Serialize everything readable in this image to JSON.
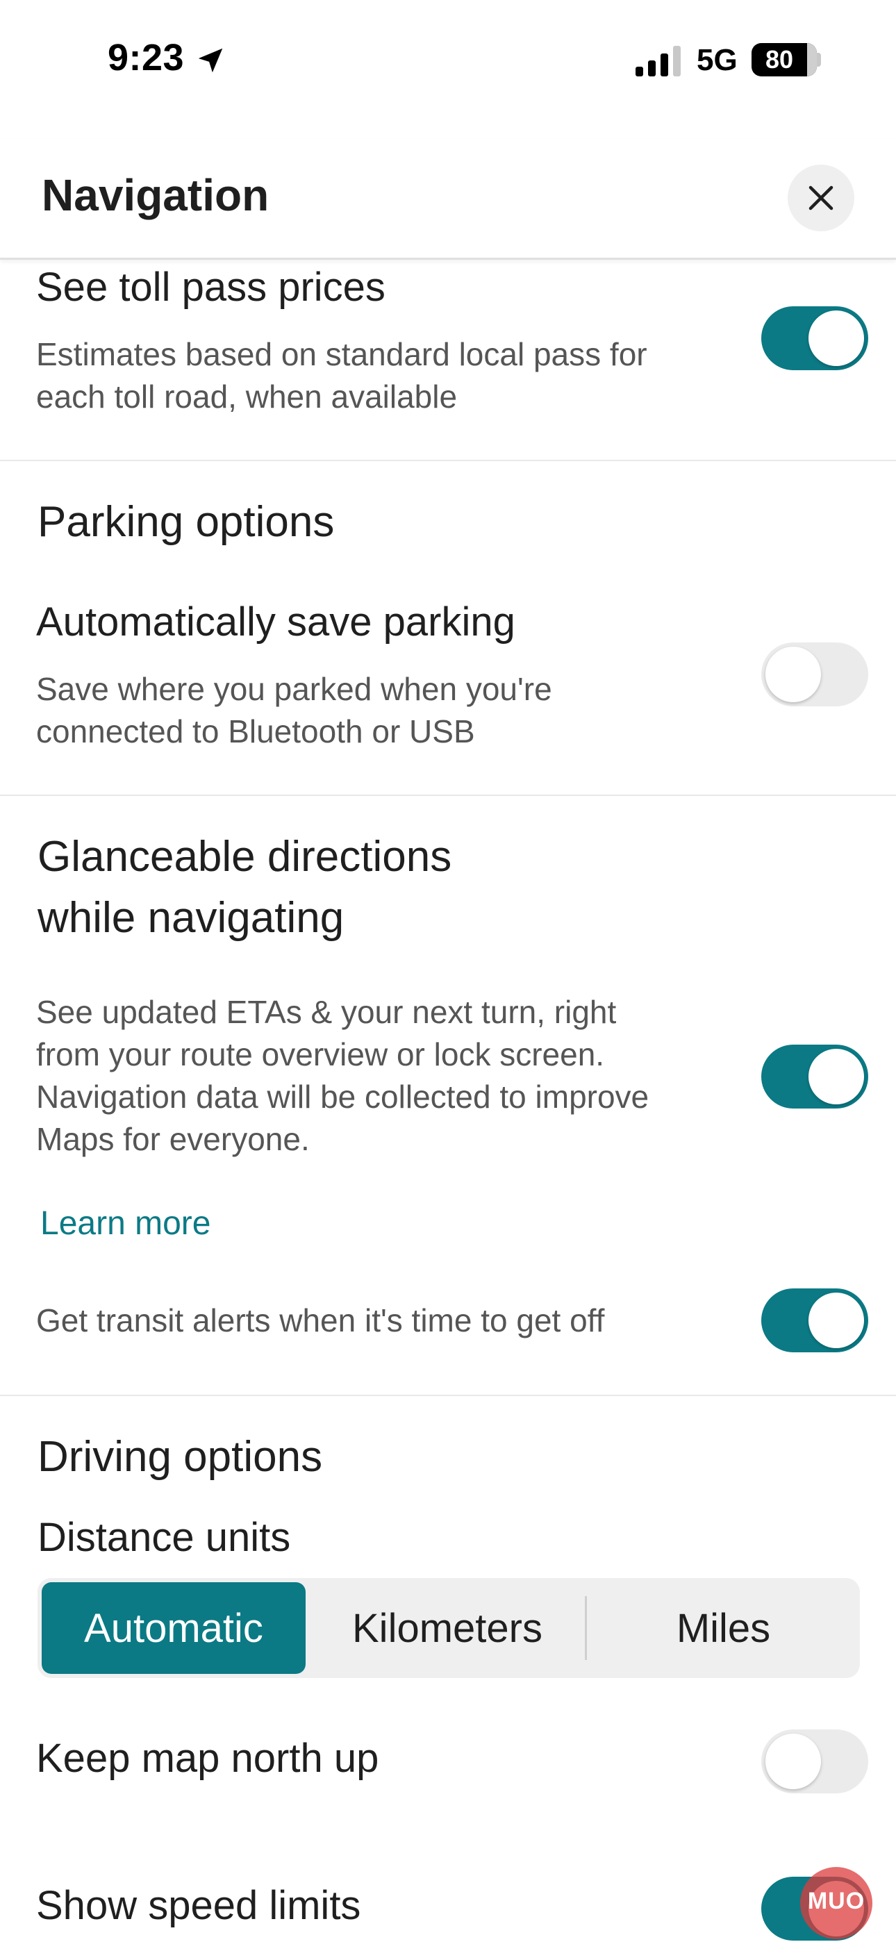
{
  "status_bar": {
    "time": "9:23",
    "network": "5G",
    "battery": "80"
  },
  "header": {
    "title": "Navigation"
  },
  "settings": {
    "toll_pass": {
      "title": "See toll pass prices",
      "description_1": "Estimates based on standard local pass for",
      "description_2": "each toll road, when available",
      "enabled": true
    },
    "parking_section": "Parking options",
    "save_parking": {
      "title": "Automatically save parking",
      "description_1": "Save where you parked when you're",
      "description_2": "connected to Bluetooth or USB",
      "enabled": false
    },
    "glanceable": {
      "title_1": "Glanceable directions",
      "title_2": "while navigating",
      "description_1": "See updated ETAs & your next turn, right",
      "description_2": "from your route overview or lock screen.",
      "description_3": "Navigation data will be collected to improve",
      "description_4": "Maps for everyone.",
      "enabled": true,
      "learn_more": "Learn more"
    },
    "transit_alerts": {
      "label": "Get transit alerts when it's time to get off",
      "enabled": true
    },
    "driving_section": "Driving options",
    "distance_units": {
      "label": "Distance units",
      "options": [
        "Automatic",
        "Kilometers",
        "Miles"
      ],
      "selected": "Automatic"
    },
    "north_up": {
      "label": "Keep map north up",
      "enabled": false
    },
    "speed_limits": {
      "label": "Show speed limits",
      "enabled": true
    }
  },
  "colors": {
    "accent": "#0b7a85",
    "toggle_off": "#ebebeb"
  },
  "watermark": "MUO"
}
